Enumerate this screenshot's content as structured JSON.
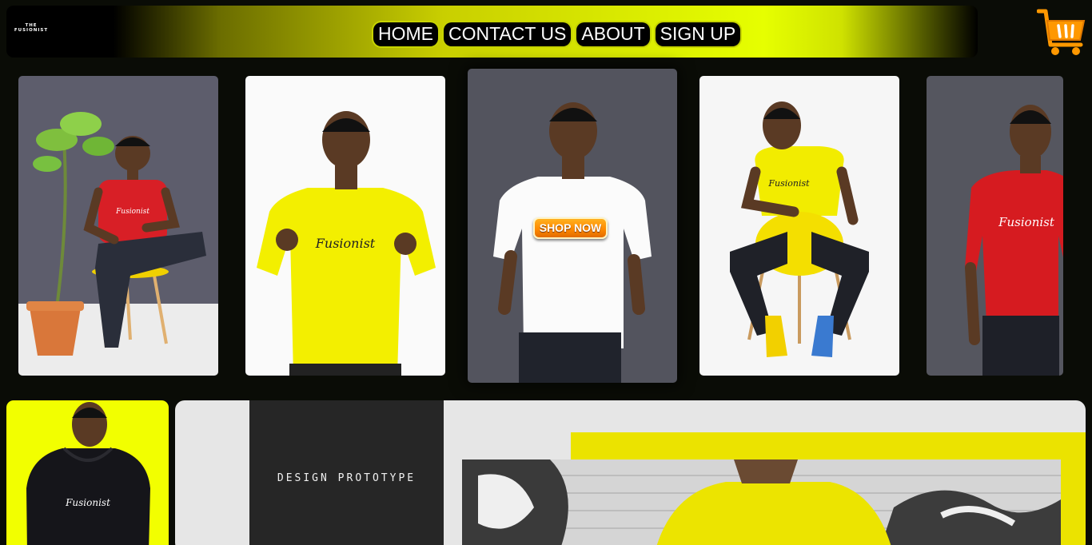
{
  "header": {
    "logo_line1": "THE",
    "logo_line2": "FUSIONIST"
  },
  "nav": {
    "items": [
      "HOME",
      "CONTACT US",
      "ABOUT",
      "SIGN UP"
    ]
  },
  "gallery": {
    "shop_now_label": "SHOP NOW",
    "shirt_text": "Fusionist"
  },
  "prototype": {
    "title": "DESIGN PROTOTYPE"
  },
  "colors": {
    "accent_yellow": "#f2ff00",
    "cart_orange": "#ff9800",
    "background": "#0a0c06"
  },
  "icons": {
    "cart": "shopping-cart-icon"
  }
}
